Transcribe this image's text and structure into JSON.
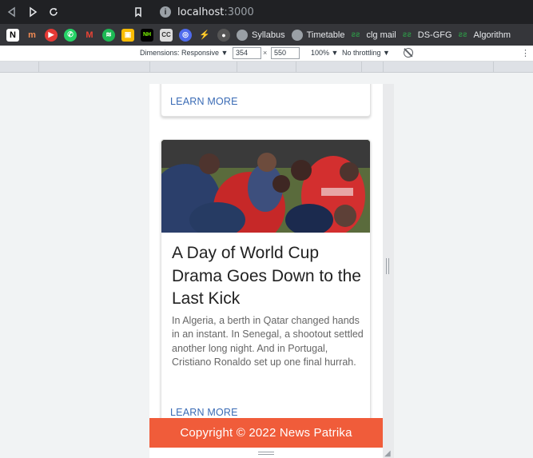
{
  "browser": {
    "url_host": "localhost",
    "url_port": ":3000"
  },
  "bookmarks": [
    {
      "label": "Syllabus"
    },
    {
      "label": "Timetable"
    },
    {
      "label": "clg mail"
    },
    {
      "label": "DS-GFG"
    },
    {
      "label": "Algorithm"
    }
  ],
  "devtools": {
    "dimensions_label": "Dimensions: Responsive ▼",
    "width": "354",
    "height": "550",
    "times": "×",
    "zoom": "100% ▼",
    "throttling": "No throttling ▼"
  },
  "cards": {
    "top_learn_more": "LEARN MORE",
    "main": {
      "title": "A Day of World Cup Drama Goes Down to the Last Kick",
      "description": "In Algeria, a berth in Qatar changed hands in an instant. In Senegal, a shootout settled another long night. And in Portugal, Cristiano Ronaldo set up one final hurrah.",
      "learn_more": "LEARN MORE"
    }
  },
  "footer": {
    "text": "Copyright © 2022 News Patrika"
  },
  "colors": {
    "footer_bg": "#f05c3a",
    "link": "#3a6bb5"
  }
}
